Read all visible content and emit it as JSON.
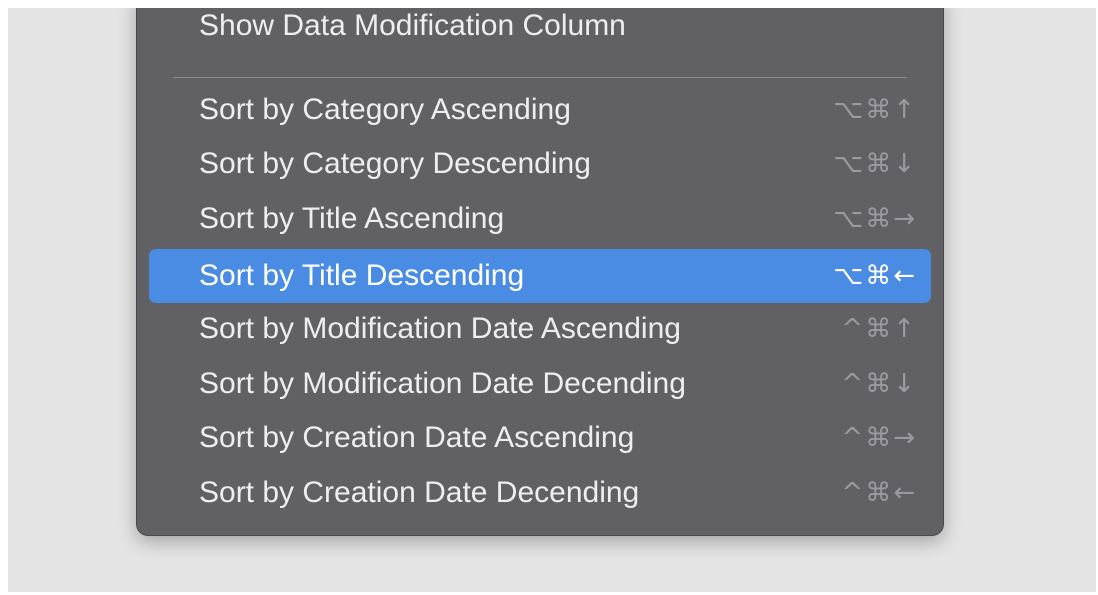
{
  "menu": {
    "top_item": {
      "label": "Show Data Modification Column"
    },
    "items": [
      {
        "label": "Sort by Category Ascending",
        "shortcut": "⌥⌘↑",
        "highlighted": false
      },
      {
        "label": "Sort by Category Descending",
        "shortcut": "⌥⌘↓",
        "highlighted": false
      },
      {
        "label": "Sort by Title Ascending",
        "shortcut": "⌥⌘→",
        "highlighted": false
      },
      {
        "label": "Sort by Title Descending",
        "shortcut": "⌥⌘←",
        "highlighted": true
      },
      {
        "label": "Sort by Modification Date Ascending",
        "shortcut": "^⌘↑",
        "highlighted": false
      },
      {
        "label": "Sort by Modification Date Decending",
        "shortcut": "^⌘↓",
        "highlighted": false
      },
      {
        "label": "Sort by Creation Date Ascending",
        "shortcut": "^⌘→",
        "highlighted": false
      },
      {
        "label": "Sort by Creation Date Decending",
        "shortcut": "^⌘←",
        "highlighted": false
      }
    ]
  },
  "colors": {
    "menu_background": "#616065",
    "highlight": "#4a8ce4",
    "backdrop": "#e4e4e4"
  }
}
